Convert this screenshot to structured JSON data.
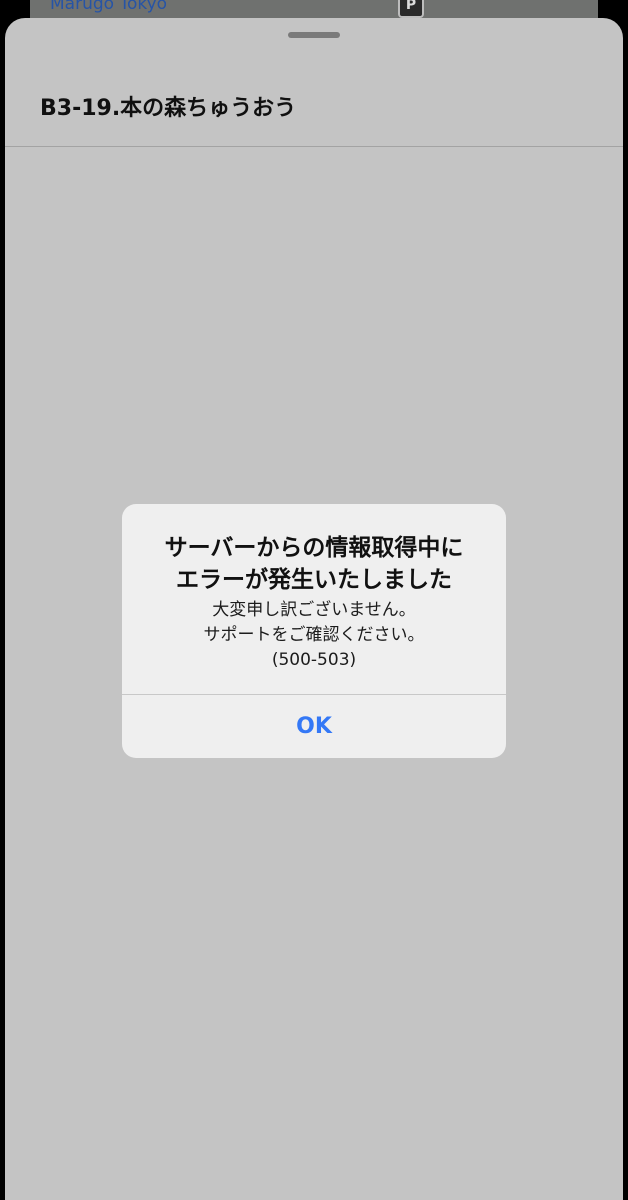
{
  "background": {
    "map_label": "Marugo Tokyo",
    "parking_glyph": "P"
  },
  "sheet": {
    "title": "B3-19.本の森ちゅうおう"
  },
  "alert": {
    "title_lines": [
      "サーバーからの情報取得中に",
      "エラーが発生いたしました"
    ],
    "message_lines": [
      "大変申し訳ございません。",
      "サポートをご確認ください。",
      "(500-503)"
    ],
    "ok_label": "OK"
  },
  "colors": {
    "sheet_bg": "#c4c4c4",
    "alert_bg": "#efefef",
    "accent": "#3478f6"
  }
}
